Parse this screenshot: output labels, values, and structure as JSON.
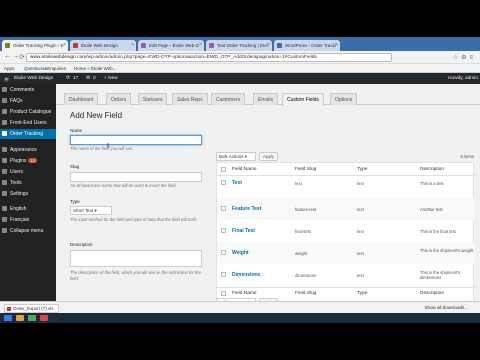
{
  "browser": {
    "tabs": [
      {
        "label": "Order Tracking Plugin › E",
        "color": "#6b8a23"
      },
      {
        "label": "Étoile Web Design",
        "color": "#c0392b"
      },
      {
        "label": "Edit Page ‹ Étoile Web D",
        "color": "#9b59b6"
      },
      {
        "label": "Test Order Tracking | Étoi",
        "color": "#9b59b6"
      },
      {
        "label": "WordPress › Order Tracki",
        "color": "#3b6ea8"
      }
    ],
    "url_domain": "www.etoilewebdesign.com",
    "url_path": "/wp-admin/admin.php?page=EWD-OTP-options&action=EWD_OTP_AddOrder&pagination=1#CustomFields",
    "bookmarks": [
      "Apps",
      "Questions&Enquiries",
      "Home » Étoile Web..."
    ]
  },
  "adminbar": {
    "site": "Étoile Web Design",
    "updates": "17",
    "comments": "0",
    "new_label": "+ New",
    "greeting": "Howdy, admin"
  },
  "sidebar": {
    "items": [
      {
        "label": "Comments"
      },
      {
        "label": "FAQs"
      },
      {
        "label": "Product Catalogue"
      },
      {
        "label": "Front-End Users"
      },
      {
        "label": "Order Tracking",
        "active": true
      },
      {
        "label": "Appearance"
      },
      {
        "label": "Plugins",
        "badge": "13"
      },
      {
        "label": "Users"
      },
      {
        "label": "Tools"
      },
      {
        "label": "Settings"
      },
      {
        "label": "English"
      },
      {
        "label": "Français"
      },
      {
        "label": "Collapse menu"
      }
    ]
  },
  "navtabs": [
    "Dashboard",
    "Orders",
    "Statuses",
    "Sales Reps",
    "Customers",
    "Emails",
    "Custom Fields",
    "Options"
  ],
  "form": {
    "title": "Add New Field",
    "name_label": "Name",
    "name_desc": "The name of the field you will see.",
    "slug_label": "Slug",
    "slug_desc": "An all-lowercase name that will be used to insert the field.",
    "type_label": "Type",
    "type_value": "Short Text",
    "type_desc": "The input method for the field and type of data that the field will hold.",
    "desc_label": "Description",
    "desc_desc": "The description of the field, which you will see as the instruction for the field."
  },
  "table": {
    "bulk_label": "Bulk Actions",
    "apply_label": "Apply",
    "items_count": "5 items",
    "columns": [
      "Field Name",
      "Field Slug",
      "Type",
      "Description"
    ],
    "rows": [
      {
        "name": "Text",
        "slug": "text",
        "type": "text",
        "desc": "This is a test"
      },
      {
        "name": "Feature Test",
        "slug": "feature-test",
        "type": "text",
        "desc": "Another test"
      },
      {
        "name": "Final Test",
        "slug": "final-test",
        "type": "text",
        "desc": "This is the final test"
      },
      {
        "name": "Weight",
        "slug": "weight",
        "type": "text",
        "desc": "This is the shipment's weight"
      },
      {
        "name": "Dimensions",
        "slug": "dimensions",
        "type": "text",
        "desc": "This is the shipment's dimensions"
      }
    ]
  },
  "downloads": {
    "file": "Order_Export (7).xls",
    "show_all": "Show all downloads..."
  }
}
